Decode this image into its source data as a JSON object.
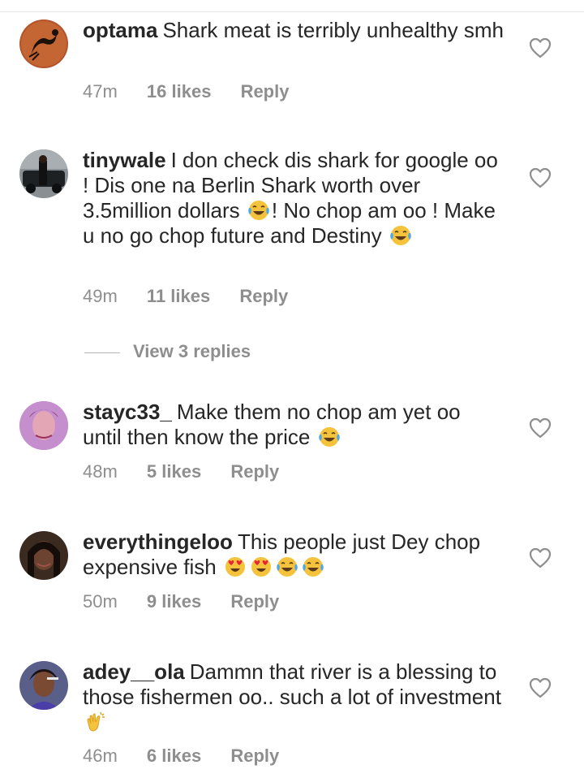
{
  "comments": [
    {
      "username": "optama",
      "text_parts": [
        "Shark meat is terribly unhealthy smh"
      ],
      "time": "47m",
      "likes": "16 likes",
      "reply": "Reply"
    },
    {
      "username": "tinywale",
      "text_parts": [
        "I don check dis shark for google oo ! Dis one na Berlin Shark worth over 3.5million dollars",
        "! No chop am oo ! Make u no go chop future and Destiny"
      ],
      "time": "49m",
      "likes": "11 likes",
      "reply": "Reply",
      "view_replies": "View 3 replies"
    },
    {
      "username": "stayc33_",
      "text_parts": [
        "Make them no chop am yet oo until then know the price"
      ],
      "time": "48m",
      "likes": "5 likes",
      "reply": "Reply"
    },
    {
      "username": "everythingeloo",
      "text_parts": [
        "This people just Dey chop expensive fish"
      ],
      "time": "50m",
      "likes": "9 likes",
      "reply": "Reply"
    },
    {
      "username": "adey__ola",
      "text_parts": [
        "Dammn that river is a blessing to those fishermen oo.. such a lot of investment"
      ],
      "time": "46m",
      "likes": "6 likes",
      "reply": "Reply"
    }
  ],
  "icons": {
    "like": "heart-outline-icon",
    "laugh": "tears-of-joy-emoji",
    "love": "heart-eyes-emoji",
    "clap": "clapping-hands-emoji"
  },
  "colors": {
    "text": "#262626",
    "meta": "#8e8e8e",
    "emoji": "#f5c33b"
  }
}
